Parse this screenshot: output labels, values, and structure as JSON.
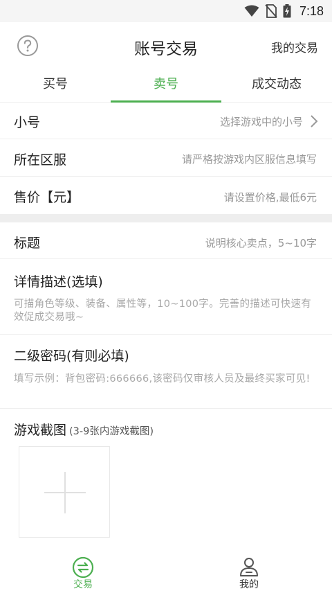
{
  "status_bar": {
    "time": "7:18",
    "icons": [
      "wifi-icon",
      "no-sim-icon",
      "battery-charging-icon"
    ]
  },
  "header": {
    "title": "账号交易",
    "right_link": "我的交易",
    "help_icon": "question-circle-icon"
  },
  "tabs": [
    {
      "label": "买号",
      "active": false
    },
    {
      "label": "卖号",
      "active": true
    },
    {
      "label": "成交动态",
      "active": false
    }
  ],
  "form": {
    "account": {
      "label": "小号",
      "placeholder": "选择游戏中的小号"
    },
    "server": {
      "label": "所在区服",
      "placeholder": "请严格按游戏内区服信息填写"
    },
    "price": {
      "label": "售价【元】",
      "placeholder": "请设置价格,最低6元"
    },
    "title": {
      "label": "标题",
      "placeholder": "说明核心卖点，5~10字"
    },
    "description": {
      "label": "详情描述(选填)",
      "placeholder": "可描角色等级、装备、属性等，10~100字。完善的描述可快速有效促成交易哦~"
    },
    "password": {
      "label": "二级密码(有则必填)",
      "placeholder": "填写示例：背包密码:666666,该密码仅审核人员及最终买家可见!"
    },
    "screenshots": {
      "label": "游戏截图",
      "hint": "(3-9张内游戏截图)"
    }
  },
  "bottom_nav": [
    {
      "label": "交易",
      "icon": "exchange-icon",
      "active": true
    },
    {
      "label": "我的",
      "icon": "user-icon",
      "active": false
    }
  ],
  "colors": {
    "accent": "#4caf50",
    "hint": "#999999",
    "divider": "#eeeeee"
  }
}
